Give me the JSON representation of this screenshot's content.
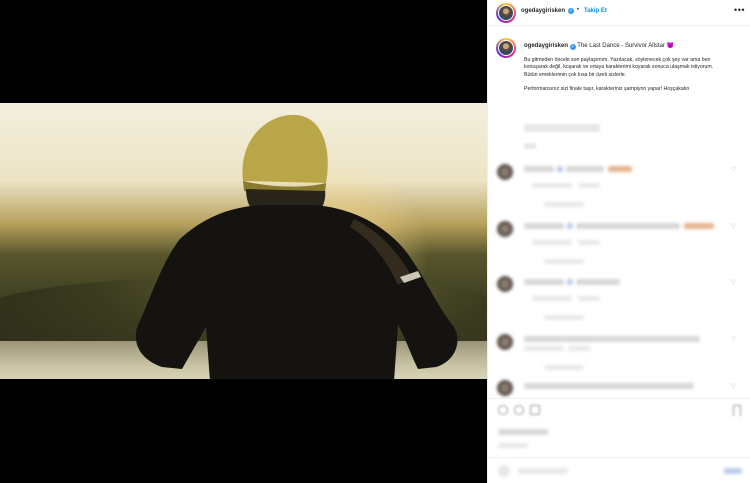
{
  "post": {
    "username": "ogedaygirisken",
    "follow_label": "Takip Et",
    "more_label": "•••",
    "dot": "•",
    "verified_mark": "✓",
    "caption_title_rest": "The Last Dance - Survivor Allstar",
    "caption_emoji": "😈",
    "caption_p1": "Bu gitmeden önceki son paylaşımım. Yazılacak, söylenecek çok şey var ama ben konuşarak değil, koşarak ve ortaya karakterimi koyarak sonuca ulaşmak istiyorum. Bütün emeklerimin çok kısa bir özeti sizlerle.",
    "caption_p2": "Performansınız sizi finale taşır, karakteriniz şampiyon yapar! Hoşçakalın"
  },
  "comments": {
    "heart_icon": "♡"
  },
  "colors": {
    "link_blue": "#0095f6",
    "verified_blue": "#3897f0",
    "text": "#262626",
    "media_bg": "#000000"
  }
}
